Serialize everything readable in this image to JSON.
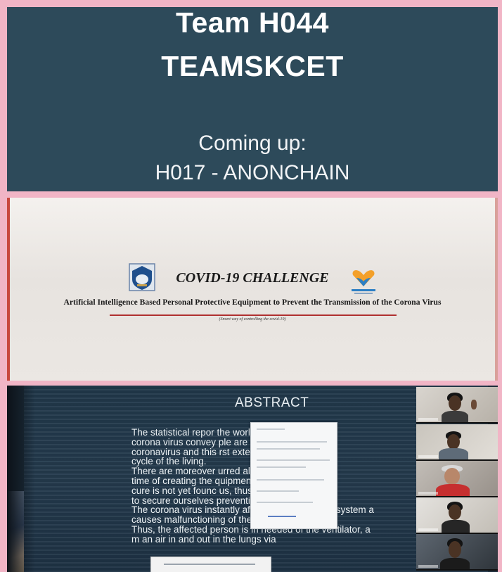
{
  "title_slide": {
    "team_line": "Team H044",
    "team_name": "TEAMSKCET",
    "coming_label": "Coming up:",
    "next_team": "H017 - ANONCHAIN",
    "background": "#2d4a5a"
  },
  "covid_slide": {
    "title": "COVID-19 CHALLENGE",
    "subtitle": "Artificial Intelligence Based Personal Protective Equipment to Prevent the Transmission of the Corona Virus",
    "tagline": "(Smart way of controlling the covid-19)",
    "accent": "#b03030"
  },
  "abstract_slide": {
    "heading": "ABSTRACT",
    "lines": [
      "The statistical repor                                the world due to t",
      "corona virus convey                               ple are affected by",
      "coronavirus and this                                rst extent to the lif",
      "cycle of the living.",
      " There are moreover                               urred already at th",
      "time of creating the                               quipment's. Still th",
      "cure is not yet founc                              us, thus the only w",
      "to secure ourselves                                preventive meas",
      "The corona virus instantly affects the respiratory system a",
      "causes malfunctioning of the human body.",
      "Thus, the affected person is in needed of the ventilator, a",
      "                               m an air in and out in the lungs via"
    ]
  },
  "participants": [
    {
      "icon": "person-waving-icon"
    },
    {
      "icon": "person-icon"
    },
    {
      "icon": "person-red-shirt-icon"
    },
    {
      "icon": "person-icon"
    },
    {
      "icon": "person-icon"
    }
  ]
}
